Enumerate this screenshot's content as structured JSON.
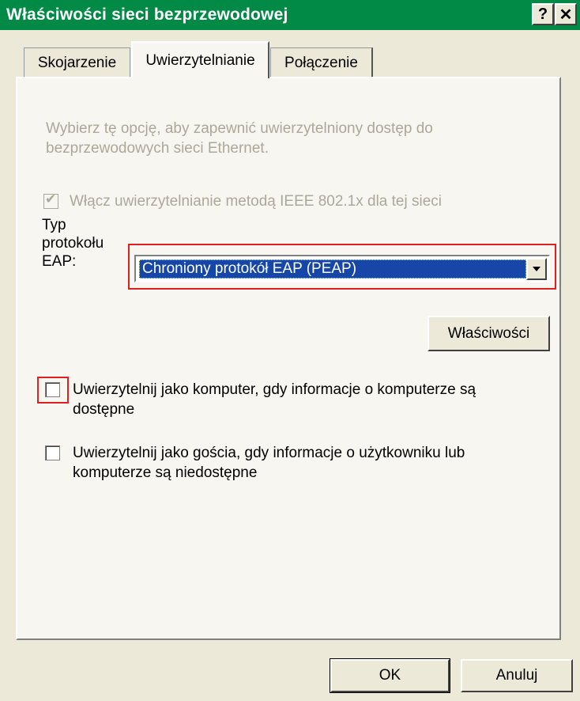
{
  "window": {
    "title": "Właściwości sieci bezprzewodowej",
    "help_glyph": "?",
    "close_glyph": "✕"
  },
  "tabs": [
    {
      "label": "Skojarzenie",
      "active": false
    },
    {
      "label": "Uwierzytelnianie",
      "active": true
    },
    {
      "label": "Połączenie",
      "active": false
    }
  ],
  "auth": {
    "description": "Wybierz tę opcję, aby zapewnić uwierzytelniony dostęp do bezprzewodowych sieci Ethernet.",
    "enable_8021x": {
      "label": "Włącz uwierzytelnianie metodą IEEE 802.1x dla tej sieci",
      "checked": true,
      "disabled": true
    },
    "eap_type_label_1": "Typ",
    "eap_type_label_2": "protokołu",
    "eap_type_label_3": "EAP:",
    "eap_type_value": "Chroniony protokół EAP (PEAP)",
    "properties_button": "Właściwości",
    "auth_as_computer": {
      "label_1": "Uwierzytelnij jako komputer, gdy informacje o komputerze są",
      "label_2": "dostępne",
      "checked": false
    },
    "auth_as_guest": {
      "label_1": "Uwierzytelnij jako gościa, gdy informacje o użytkowniku lub",
      "label_2": "komputerze są niedostępne",
      "checked": false
    }
  },
  "footer": {
    "ok": "OK",
    "cancel": "Anuluj"
  },
  "colors": {
    "titlebar": "#008a46",
    "highlight": "#e02020",
    "selection": "#1546a8"
  }
}
